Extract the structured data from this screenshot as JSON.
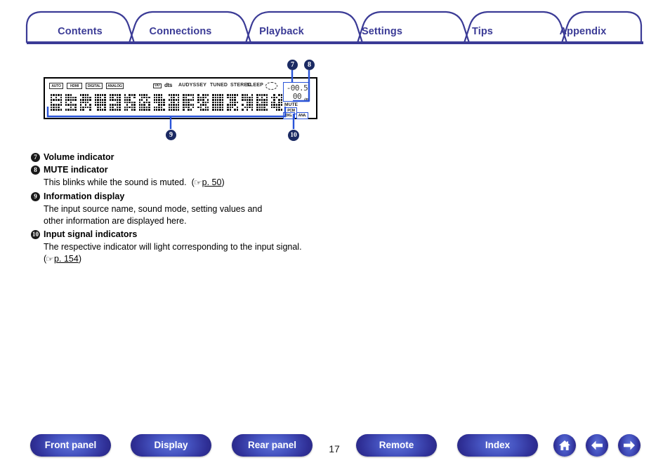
{
  "tabs": [
    {
      "label": "Contents"
    },
    {
      "label": "Connections"
    },
    {
      "label": "Playback"
    },
    {
      "label": "Settings"
    },
    {
      "label": "Tips"
    },
    {
      "label": "Appendix"
    }
  ],
  "figure": {
    "callouts": [
      {
        "id": "7",
        "glyph": "7"
      },
      {
        "id": "8",
        "glyph": "8"
      },
      {
        "id": "9",
        "glyph": "9"
      },
      {
        "id": "10",
        "glyph": "10"
      }
    ],
    "format_indicators": [
      {
        "label": "AUTO"
      },
      {
        "label": "HDMI"
      },
      {
        "label": "DIGITAL"
      },
      {
        "label": "ANALOG"
      }
    ],
    "dolby_label": "DD",
    "dts_label": "dts",
    "mode_indicators": [
      {
        "label": "AUDYSSEY"
      },
      {
        "label": "TUNED"
      },
      {
        "label": "STEREO"
      },
      {
        "label": "SLEEP"
      }
    ],
    "sleep_icon": "sleep-timer-icon",
    "volume": {
      "top_line": "-00.5",
      "bottom_line": "00",
      "unit": "dB"
    },
    "mute_label": "MUTE",
    "signal_indicators": [
      {
        "label": "PCM"
      },
      {
        "label": "DIG."
      },
      {
        "label": "ANA."
      }
    ]
  },
  "entries": [
    {
      "num": "7",
      "title": "Volume indicator",
      "body": "",
      "link_prefix": "",
      "link": "",
      "link_suffix": ""
    },
    {
      "num": "8",
      "title": "MUTE indicator",
      "body": "This blinks while the sound is muted.",
      "link_prefix": "(",
      "link": "p. 50",
      "link_suffix": ")"
    },
    {
      "num": "9",
      "title": "Information display",
      "body": "The input source name, sound mode, setting values and other information are displayed here.",
      "link_prefix": "",
      "link": "",
      "link_suffix": ""
    },
    {
      "num": "10",
      "title": "Input signal indicators",
      "body": "The respective indicator will light corresponding to the input signal.",
      "link_prefix": "(",
      "link": "p. 154",
      "link_suffix": ")"
    }
  ],
  "footer": {
    "buttons": [
      {
        "label": "Front panel"
      },
      {
        "label": "Display"
      },
      {
        "label": "Rear panel"
      },
      {
        "label": "Remote"
      },
      {
        "label": "Index"
      }
    ],
    "page_number": "17",
    "nav_icons": [
      {
        "name": "home-icon"
      },
      {
        "name": "arrow-left-icon"
      },
      {
        "name": "arrow-right-icon"
      }
    ]
  },
  "colors": {
    "accent": "#3b3b96",
    "annotation": "#2a54d8",
    "bubble": "#1b2a63"
  }
}
